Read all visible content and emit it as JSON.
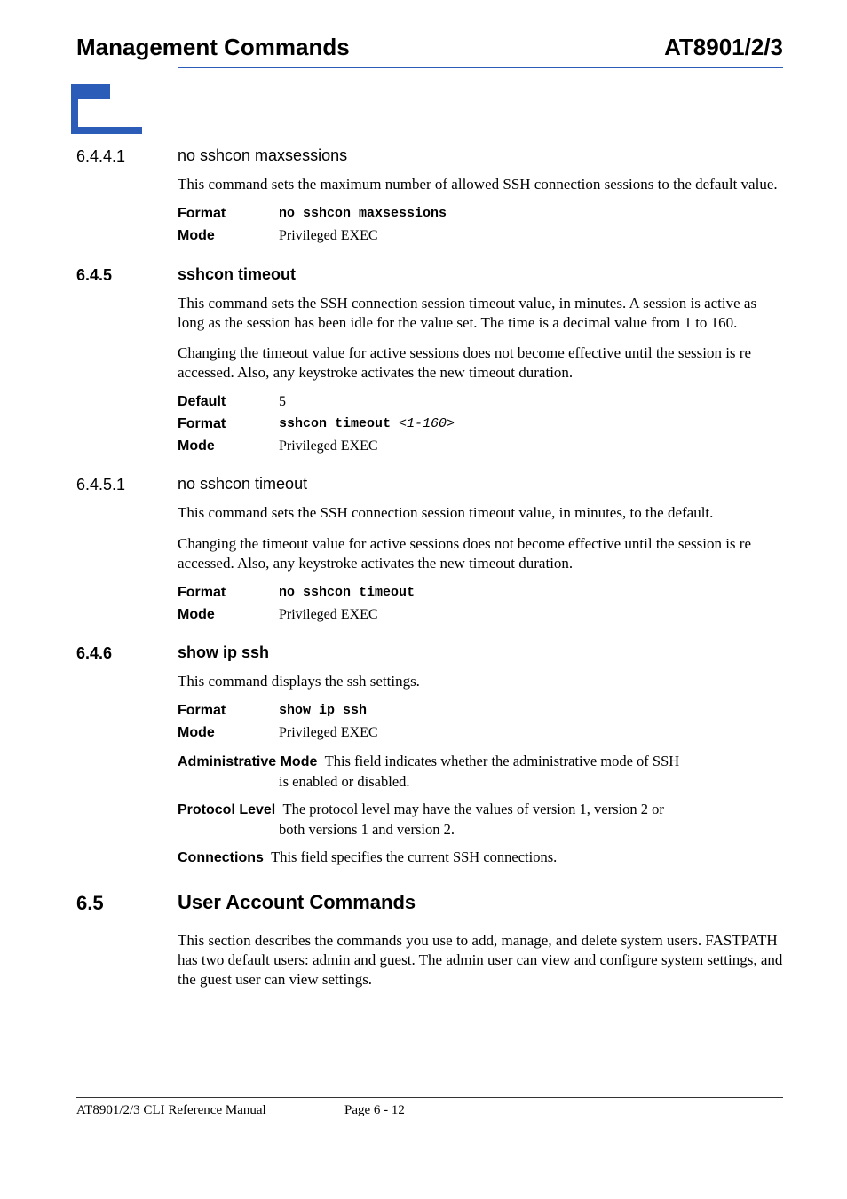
{
  "header": {
    "left": "Management Commands",
    "right": "AT8901/2/3"
  },
  "sections": {
    "s6441": {
      "num": "6.4.4.1",
      "title": "no sshcon maxsessions",
      "para1": "This command sets the maximum number of allowed SSH connection sessions to the default value.",
      "format_label": "Format",
      "format_val": "no sshcon maxsessions",
      "mode_label": "Mode",
      "mode_val": "Privileged EXEC"
    },
    "s645": {
      "num": "6.4.5",
      "title": "sshcon timeout",
      "para1": "This command sets the SSH connection session timeout value, in minutes. A session is active as long as the session has been idle for the value set. The time is a decimal value from 1 to 160.",
      "para2": "Changing the timeout value for active sessions does not become effective until the session is re accessed. Also, any keystroke activates the new timeout duration.",
      "default_label": "Default",
      "default_val": "5",
      "format_label": "Format",
      "format_cmd": "sshcon timeout ",
      "format_arg": "<1-160>",
      "mode_label": "Mode",
      "mode_val": "Privileged EXEC"
    },
    "s6451": {
      "num": "6.4.5.1",
      "title": "no sshcon timeout",
      "para1": "This command sets the SSH connection session timeout value, in minutes, to the default.",
      "para2": "Changing the timeout value for active sessions does not become effective until the session is re accessed. Also, any keystroke activates the new timeout duration.",
      "format_label": "Format",
      "format_val": "no sshcon timeout",
      "mode_label": "Mode",
      "mode_val": "Privileged EXEC"
    },
    "s646": {
      "num": "6.4.6",
      "title": "show ip ssh",
      "para1": "This command displays the ssh settings.",
      "format_label": "Format",
      "format_val": "show ip ssh",
      "mode_label": "Mode",
      "mode_val": "Privileged EXEC",
      "f1_name": "Administrative Mode",
      "f1_text_a": "This field indicates whether the administrative mode of SSH",
      "f1_text_b": "is enabled or disabled.",
      "f2_name": "Protocol Level",
      "f2_text_a": "The protocol level may have the values of version 1, version 2 or",
      "f2_text_b": "both versions 1 and version 2.",
      "f3_name": "Connections",
      "f3_text": "This field specifies the current SSH connections."
    },
    "s65": {
      "num": "6.5",
      "title": "User Account Commands",
      "para1": "This section describes the commands you use to add, manage, and delete system users. FASTPATH has two default users: admin and guest. The admin user can view and configure system settings, and the guest user can view settings."
    }
  },
  "footer": {
    "left": "AT8901/2/3 CLI Reference Manual",
    "center": "Page 6 - 12"
  }
}
